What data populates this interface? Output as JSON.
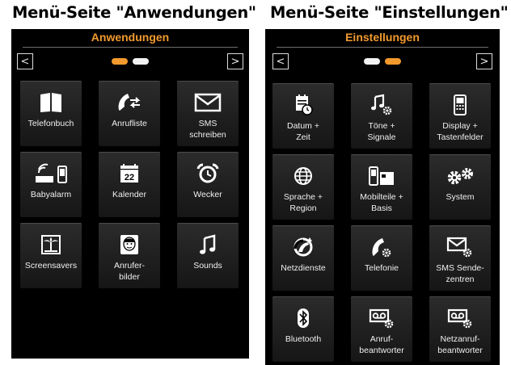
{
  "captions": {
    "left": "Menü-Seite \"Anwendungen\"",
    "right": "Menü-Seite \"Einstellungen\""
  },
  "screens": {
    "anwendungen": {
      "title": "Anwendungen",
      "prev_glyph": "<",
      "next_glyph": ">",
      "active_page": 1,
      "page_count": 2,
      "tiles": [
        {
          "label": "Telefonbuch",
          "icon": "phonebook-icon"
        },
        {
          "label": "Anrufliste",
          "icon": "call-list-icon"
        },
        {
          "label": "SMS\nschreiben",
          "icon": "envelope-icon"
        },
        {
          "label": "Babyalarm",
          "icon": "babyalarm-icon"
        },
        {
          "label": "Kalender",
          "icon": "calendar-icon"
        },
        {
          "label": "Wecker",
          "icon": "alarm-clock-icon"
        },
        {
          "label": "Screensavers",
          "icon": "palm-tree-icon"
        },
        {
          "label": "Anrufer-\nbilder",
          "icon": "face-icon"
        },
        {
          "label": "Sounds",
          "icon": "music-note-icon"
        }
      ],
      "calendar_day": "22"
    },
    "einstellungen": {
      "title": "Einstellungen",
      "prev_glyph": "<",
      "next_glyph": ">",
      "active_page": 2,
      "page_count": 2,
      "tiles": [
        {
          "label": "Datum +\nZeit",
          "icon": "date-time-icon"
        },
        {
          "label": "Töne +\nSignale",
          "icon": "tones-icon"
        },
        {
          "label": "Display +\nTastenfelder",
          "icon": "display-icon"
        },
        {
          "label": "Sprache +\nRegion",
          "icon": "globe-icon"
        },
        {
          "label": "Mobilteile +\nBasis",
          "icon": "handset-base-icon"
        },
        {
          "label": "System",
          "icon": "gears-icon"
        },
        {
          "label": "Netzdienste",
          "icon": "network-services-icon"
        },
        {
          "label": "Telefonie",
          "icon": "telephony-icon"
        },
        {
          "label": "SMS Sende-\nzentren",
          "icon": "sms-center-icon"
        },
        {
          "label": "Bluetooth",
          "icon": "bluetooth-icon"
        },
        {
          "label": "Anruf-\nbeantworter",
          "icon": "answering-machine-icon"
        },
        {
          "label": "Netzanruf-\nbeantworter",
          "icon": "network-mailbox-icon"
        }
      ]
    }
  },
  "colors": {
    "accent_orange": "#f29a2e",
    "dot_inactive": "#f2f2f2",
    "screen_bg": "#000000",
    "tile_bg": "#222222"
  }
}
